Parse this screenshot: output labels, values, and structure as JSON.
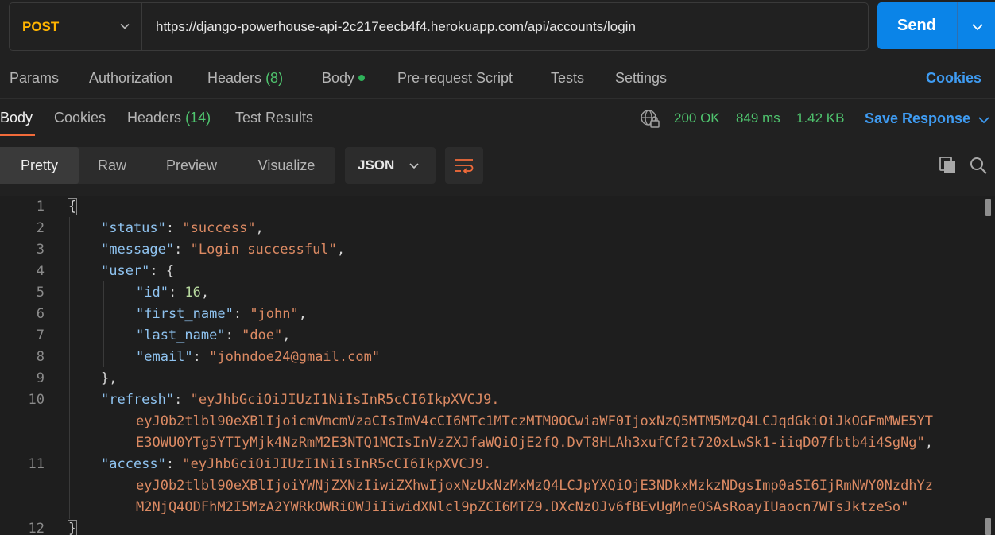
{
  "request": {
    "method": "POST",
    "url": "https://django-powerhouse-api-2c217eecb4f4.herokuapp.com/api/accounts/login",
    "send_label": "Send"
  },
  "request_tabs": {
    "params": "Params",
    "authorization": "Authorization",
    "headers": "Headers",
    "headers_count": "(8)",
    "body": "Body",
    "prerequest": "Pre-request Script",
    "tests": "Tests",
    "settings": "Settings",
    "cookies": "Cookies"
  },
  "response_tabs": {
    "body": "Body",
    "cookies": "Cookies",
    "headers": "Headers",
    "headers_count": "(14)",
    "test_results": "Test Results"
  },
  "response_status": {
    "status": "200 OK",
    "time": "849 ms",
    "size": "1.42 KB",
    "save_label": "Save Response"
  },
  "view_modes": {
    "pretty": "Pretty",
    "raw": "Raw",
    "preview": "Preview",
    "visualize": "Visualize",
    "format": "JSON"
  },
  "code": {
    "line_numbers": [
      "1",
      "2",
      "3",
      "4",
      "5",
      "6",
      "7",
      "8",
      "9",
      "10",
      "11",
      "12"
    ],
    "status_key": "\"status\"",
    "status_val": "\"success\"",
    "message_key": "\"message\"",
    "message_val": "\"Login successful\"",
    "user_key": "\"user\"",
    "id_key": "\"id\"",
    "id_val": "16",
    "first_name_key": "\"first_name\"",
    "first_name_val": "\"john\"",
    "last_name_key": "\"last_name\"",
    "last_name_val": "\"doe\"",
    "email_key": "\"email\"",
    "email_val": "\"johndoe24@gmail.com\"",
    "refresh_key": "\"refresh\"",
    "refresh_val_1": "\"eyJhbGciOiJIUzI1NiIsInR5cCI6IkpXVCJ9.",
    "refresh_val_2": "eyJ0b2tlbl90eXBlIjoicmVmcmVzaCIsImV4cCI6MTc1MTczMTM0OCwiaWF0IjoxNzQ5MTM5MzQ4LCJqdGkiOiJkOGFmMWE5YT",
    "refresh_val_3": "E3OWU0YTg5YTIyMjk4NzRmM2E3NTQ1MCIsInVzZXJfaWQiOjE2fQ.DvT8HLAh3xufCf2t720xLwSk1-iiqD07fbtb4i4SgNg\"",
    "access_key": "\"access\"",
    "access_val_1": "\"eyJhbGciOiJIUzI1NiIsInR5cCI6IkpXVCJ9.",
    "access_val_2": "eyJ0b2tlbl90eXBlIjoiYWNjZXNzIiwiZXhwIjoxNzUxNzMxMzQ4LCJpYXQiOjE3NDkxMzkzNDgsImp0aSI6IjRmNWY0NzdhYz",
    "access_val_3": "M2NjQ4ODFhM2I5MzA2YWRkOWRiOWJiIiwidXNlcl9pZCI6MTZ9.DXcNzOJv6fBEvUgMneOSAsRoayIUaocn7WTsJktzeSo\""
  },
  "colors": {
    "method": "#ffb400",
    "send": "#0a84e8",
    "status_ok": "#4fc46e",
    "link": "#3f9cf3",
    "json_key": "#8fc3f0",
    "json_string": "#dc8a63",
    "json_number": "#b6d79d"
  },
  "icons": [
    "chevron-down-icon",
    "globe-lock-icon",
    "wrap-lines-icon",
    "copy-icon",
    "search-icon"
  ]
}
